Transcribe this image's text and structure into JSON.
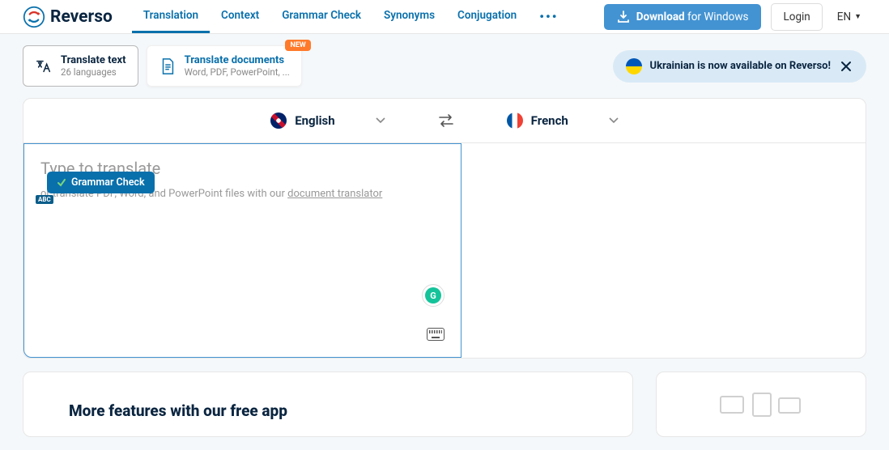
{
  "logo": "Reverso",
  "nav": [
    "Translation",
    "Context",
    "Grammar Check",
    "Synonyms",
    "Conjugation"
  ],
  "download": {
    "bold": "Download",
    "rest": " for Windows"
  },
  "login": "Login",
  "ui_lang": "EN",
  "tabs": {
    "text": {
      "title": "Translate text",
      "sub": "26 languages"
    },
    "docs": {
      "title": "Translate documents",
      "sub": "Word, PDF, PowerPoint, ...",
      "badge": "NEW"
    }
  },
  "banner": "Ukrainian is now available on Reverso!",
  "lang": {
    "src": "English",
    "tgt": "French"
  },
  "input": {
    "placeholder": "Type to translate",
    "hint_pre": "or translate PDF, Word, and PowerPoint files with our ",
    "hint_link": "document translator"
  },
  "grammar_check": "Grammar Check",
  "features_title": "More features with our free app"
}
